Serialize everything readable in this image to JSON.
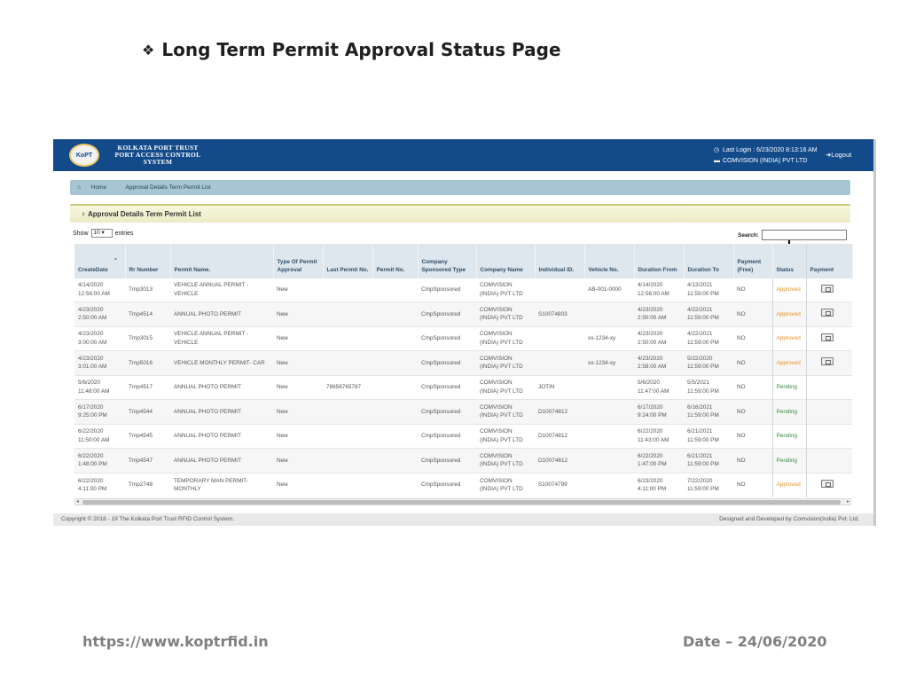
{
  "slide": {
    "title": "Long Term Permit Approval Status Page",
    "url": "https://www.koptrfid.in",
    "date": "Date – 24/06/2020"
  },
  "app": {
    "logo_line1": "KOLKATA PORT TRUST",
    "logo_line2": "PORT ACCESS CONTROL",
    "logo_line3": "SYSTEM",
    "logo_emblem": "KoPT",
    "last_login": "Last Login : 6/23/2020 8:13:16 AM",
    "company": "COMVISION (INDIA) PVT LTD",
    "logout": "Logout"
  },
  "breadcrumb": {
    "home": "Home",
    "current": "Approval Details Term Permit List"
  },
  "panel": {
    "title": "Approval Details Term Permit List"
  },
  "controls": {
    "show_label": "Show",
    "show_value": "10",
    "entries_label": "entries",
    "search_label": "Search:"
  },
  "table": {
    "headers": {
      "create_date": "CreateDate",
      "rr_number": "Rr Number",
      "permit_name": "Permit Name.",
      "type_of_permit": "Type Of Permit Approval",
      "last_permit": "Last Permit No.",
      "permit_no": "Permit No.",
      "company_sponsored": "Company Sponsored Type",
      "company_name": "Company Name",
      "individual_id": "Individual ID.",
      "vehicle_no": "Vehicle No.",
      "duration_from": "Duration From",
      "duration_to": "Duration To",
      "payment_free": "Payment (Free)",
      "status": "Status",
      "payment": "Payment"
    },
    "rows": [
      {
        "create_date": "4/14/2020 12:56:00 AM",
        "rr_number": "Tmp3013",
        "permit_name": "VEHICLE ANNUAL PERMIT - VEHICLE",
        "type": "New",
        "last_permit": "",
        "permit_no": "",
        "sponsored": "CmpSponsored",
        "company": "COMVISION (INDIA) PVT LTD",
        "individual_id": "",
        "vehicle_no": "AB-001-0000",
        "from": "4/14/2020 12:56:00 AM",
        "to": "4/13/2021 11:59:00 PM",
        "free": "NO",
        "status": "Approved",
        "pay": true
      },
      {
        "create_date": "4/23/2020 2:50:00 AM",
        "rr_number": "Tmp4514",
        "permit_name": "ANNUAL PHOTO PERMIT",
        "type": "New",
        "last_permit": "",
        "permit_no": "",
        "sponsored": "CmpSponsored",
        "company": "COMVISION (INDIA) PVT LTD",
        "individual_id": "S10074803",
        "vehicle_no": "",
        "from": "4/23/2020 2:50:00 AM",
        "to": "4/22/2021 11:59:00 PM",
        "free": "NO",
        "status": "Approved",
        "pay": true
      },
      {
        "create_date": "4/23/2020 3:00:00 AM",
        "rr_number": "Tmp3015",
        "permit_name": "VEHICLE ANNUAL PERMIT - VEHICLE",
        "type": "New",
        "last_permit": "",
        "permit_no": "",
        "sponsored": "CmpSponsored",
        "company": "COMVISION (INDIA) PVT LTD",
        "individual_id": "",
        "vehicle_no": "xx-1234-xy",
        "from": "4/23/2020 2:50:00 AM",
        "to": "4/22/2021 11:59:00 PM",
        "free": "NO",
        "status": "Approved",
        "pay": true
      },
      {
        "create_date": "4/23/2020 3:01:00 AM",
        "rr_number": "Tmp5016",
        "permit_name": "VEHICLE MONTHLY PERMIT- CAR",
        "type": "New",
        "last_permit": "",
        "permit_no": "",
        "sponsored": "CmpSponsored",
        "company": "COMVISION (INDIA) PVT LTD",
        "individual_id": "",
        "vehicle_no": "xx-1234-xy",
        "from": "4/23/2020 2:58:00 AM",
        "to": "5/22/2020 11:59:00 PM",
        "free": "NO",
        "status": "Approved",
        "pay": true
      },
      {
        "create_date": "5/6/2020 11:48:00 AM",
        "rr_number": "Tmp4517",
        "permit_name": "ANNUAL PHOTO PERMIT",
        "type": "New",
        "last_permit": "78658765787",
        "permit_no": "",
        "sponsored": "CmpSponsored",
        "company": "COMVISION (INDIA) PVT LTD",
        "individual_id": "JOTIN",
        "vehicle_no": "",
        "from": "5/6/2020 11:47:00 AM",
        "to": "5/5/2021 11:59:00 PM",
        "free": "NO",
        "status": "Pending",
        "pay": false
      },
      {
        "create_date": "6/17/2020 9:25:00 PM",
        "rr_number": "Tmp4544",
        "permit_name": "ANNUAL PHOTO PERMIT",
        "type": "New",
        "last_permit": "",
        "permit_no": "",
        "sponsored": "CmpSponsored",
        "company": "COMVISION (INDIA) PVT LTD",
        "individual_id": "D10074812",
        "vehicle_no": "",
        "from": "6/17/2020 9:24:00 PM",
        "to": "6/16/2021 11:59:00 PM",
        "free": "NO",
        "status": "Pending",
        "pay": false
      },
      {
        "create_date": "6/22/2020 11:50:00 AM",
        "rr_number": "Tmp4545",
        "permit_name": "ANNUAL PHOTO PERMIT",
        "type": "New",
        "last_permit": "",
        "permit_no": "",
        "sponsored": "CmpSponsored",
        "company": "COMVISION (INDIA) PVT LTD",
        "individual_id": "D10074812",
        "vehicle_no": "",
        "from": "6/22/2020 11:43:00 AM",
        "to": "6/21/2021 11:59:00 PM",
        "free": "NO",
        "status": "Pending",
        "pay": false
      },
      {
        "create_date": "6/22/2020 1:48:00 PM",
        "rr_number": "Tmp4547",
        "permit_name": "ANNUAL PHOTO PERMIT",
        "type": "New",
        "last_permit": "",
        "permit_no": "",
        "sponsored": "CmpSponsored",
        "company": "COMVISION (INDIA) PVT LTD",
        "individual_id": "D10074812",
        "vehicle_no": "",
        "from": "6/22/2020 1:47:00 PM",
        "to": "6/21/2021 11:59:00 PM",
        "free": "NO",
        "status": "Pending",
        "pay": false
      },
      {
        "create_date": "6/22/2020 4:11:00 PM",
        "rr_number": "Tmp2748",
        "permit_name": "TEMPORARY MAN PERMIT- MONTHLY",
        "type": "New",
        "last_permit": "",
        "permit_no": "",
        "sponsored": "CmpSponsored",
        "company": "COMVISION (INDIA) PVT LTD",
        "individual_id": "S10074799",
        "vehicle_no": "",
        "from": "6/23/2020 4:11:00 PM",
        "to": "7/22/2020 11:59:00 PM",
        "free": "NO",
        "status": "Approved",
        "pay": true
      }
    ]
  },
  "footer": {
    "copyright": "Copyright © 2018 - 19 The Kolkata Port Trust RFID Control System.",
    "credit": "Designed and Developed by Comvision(India) Pvt. Ltd."
  },
  "colors": {
    "topbar": "#134a8a",
    "approved": "#e0962e",
    "pending": "#3a8a3a"
  },
  "icons": {
    "bullet": "diamond-bullet-icon",
    "clock": "clock-icon",
    "folder": "folder-icon",
    "logout": "logout-icon",
    "home": "home-icon",
    "user": "user-icon",
    "payment": "payment-icon",
    "arrow": "arrow-down-icon"
  }
}
